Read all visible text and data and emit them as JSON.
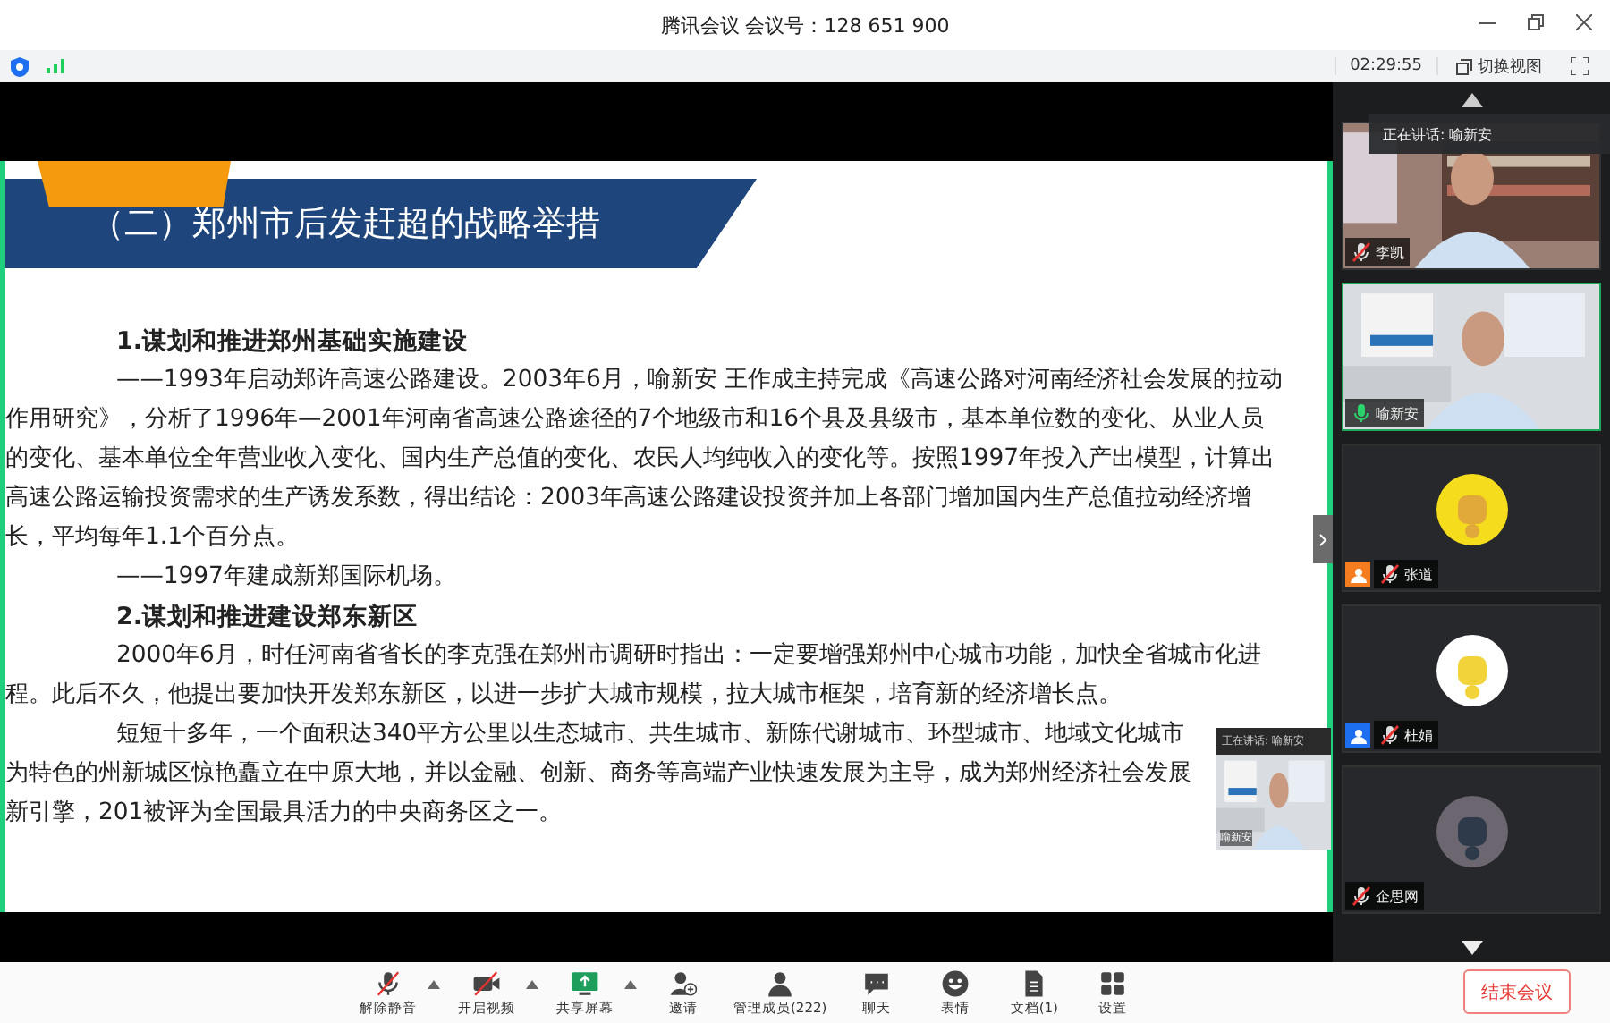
{
  "window": {
    "title": "腾讯会议 会议号：128 651 900"
  },
  "status_bar": {
    "time": "02:29:55",
    "switch_view": "切换视图"
  },
  "slide": {
    "title": "（二）郑州市后发赶超的战略举措",
    "blocks": [
      {
        "kind": "heading",
        "text": "1.谋划和推进郑州基础实施建设"
      },
      {
        "kind": "para",
        "text": "——1993年启动郑许高速公路建设。2003年6月，喻新安 王作成主持完成《高速公路对河南经济社会发展的拉动作用研究》，分析了1996年—2001年河南省高速公路途径的7个地级市和16个县及县级市，基本单位数的变化、从业人员的变化、基本单位全年营业收入变化、国内生产总值的变化、农民人均纯收入的变化等。按照1997年投入产出模型，计算出高速公路运输投资需求的生产诱发系数，得出结论：2003年高速公路建设投资并加上各部门增加国内生产总值拉动经济增长，平均每年1.1个百分点。"
      },
      {
        "kind": "para",
        "text": "——1997年建成新郑国际机场。"
      },
      {
        "kind": "heading",
        "text": "2.谋划和推进建设郑东新区"
      },
      {
        "kind": "para",
        "text": "2000年6月，时任河南省省长的李克强在郑州市调研时指出：一定要增强郑州中心城市功能，加快全省城市化进程。此后不久，他提出要加快开发郑东新区，以进一步扩大城市规模，拉大城市框架，培育新的经济增长点。"
      },
      {
        "kind": "para",
        "text": "短短十多年，一个面积达340平方公里以生态城市、共生城市、新陈代谢城市、环型城市、地域文化城市为特色的州新城区惊艳矗立在中原大地，并以金融、创新、商务等高端产业快速发展为主导，成为郑州经济社会发展新引擎，201被评为全国最具活力的中央商务区之一。"
      }
    ]
  },
  "floating_video": {
    "label": "正在讲话: 喻新安",
    "name": "喻新安"
  },
  "speaking_banner": "正在讲话: 喻新安",
  "participants": [
    {
      "name": "李凯",
      "kind": "video",
      "mic_muted": true,
      "speaking": false
    },
    {
      "name": "喻新安",
      "kind": "video",
      "mic_muted": false,
      "speaking": true
    },
    {
      "name": "张道",
      "kind": "avatar",
      "mic_muted": true,
      "speaking": false,
      "color": "#f57c1f"
    },
    {
      "name": "杜娟",
      "kind": "avatar",
      "mic_muted": true,
      "speaking": false,
      "color": "#1e6ff0"
    },
    {
      "name": "企思网",
      "kind": "avatar",
      "mic_muted": true,
      "speaking": false
    }
  ],
  "toolbar": [
    {
      "label": "解除静音",
      "caret": true
    },
    {
      "label": "开启视频",
      "caret": true
    },
    {
      "label": "共享屏幕",
      "caret": true
    },
    {
      "label": "邀请",
      "caret": false
    },
    {
      "label": "管理成员(222)",
      "caret": false
    },
    {
      "label": "聊天",
      "caret": false
    },
    {
      "label": "表情",
      "caret": false
    },
    {
      "label": "文档(1)",
      "caret": false
    },
    {
      "label": "设置",
      "caret": false
    }
  ],
  "end_button": "结束会议"
}
